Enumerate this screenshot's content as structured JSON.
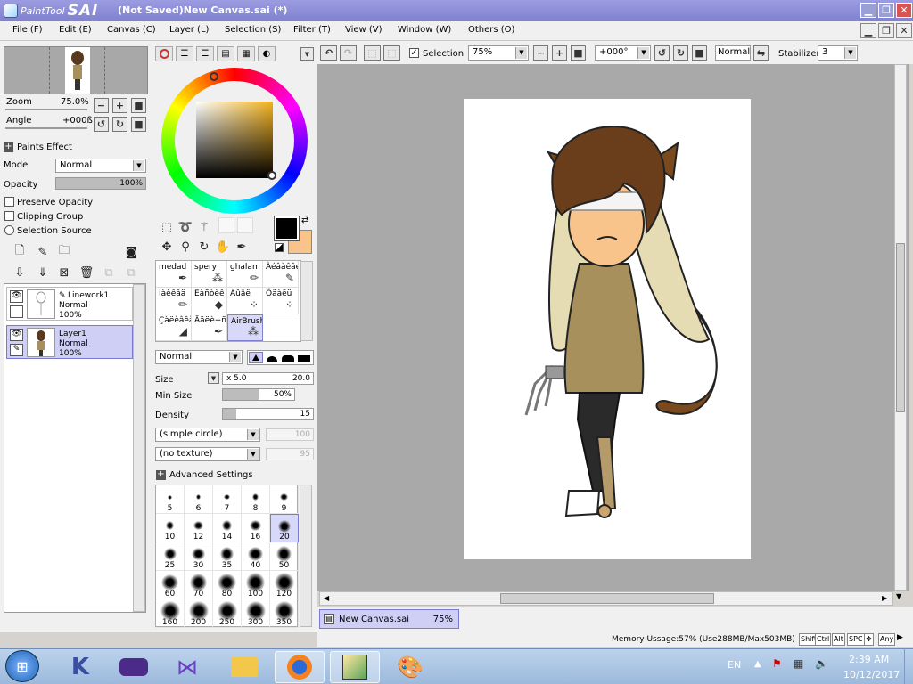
{
  "titlebar": {
    "logo_paint": "PaintTool",
    "logo_sai": "SAI",
    "title": "(Not Saved)New Canvas.sai (*)"
  },
  "menu": [
    "File (F)",
    "Edit (E)",
    "Canvas (C)",
    "Layer (L)",
    "Selection (S)",
    "Filter (T)",
    "View (V)",
    "Window (W)",
    "Others (O)"
  ],
  "navigator": {
    "zoom_label": "Zoom",
    "zoom_value": "75.0%",
    "angle_label": "Angle",
    "angle_value": "+000ß"
  },
  "paints_effect": {
    "header": "Paints Effect",
    "mode_label": "Mode",
    "mode_value": "Normal",
    "opacity_label": "Opacity",
    "opacity_value": "100%",
    "opacity_fraction": 1.0
  },
  "layer_options": {
    "preserve_opacity": "Preserve Opacity",
    "clipping_group": "Clipping Group",
    "selection_source": "Selection Source"
  },
  "layers": [
    {
      "name": "Linework1",
      "mode": "Normal",
      "opacity": "100%",
      "selected": false
    },
    {
      "name": "Layer1",
      "mode": "Normal",
      "opacity": "100%",
      "selected": true
    }
  ],
  "colors": {
    "primary": "#000000",
    "secondary": "#f9c48c",
    "accent": "#7f80d0",
    "canvas_bg": "#a9a9a9"
  },
  "brushes": [
    {
      "name": "medad",
      "icon": "pen-icon"
    },
    {
      "name": "spery",
      "icon": "spray-icon"
    },
    {
      "name": "ghalam",
      "icon": "pencil-icon"
    },
    {
      "name": "Àéâàêâé",
      "icon": "brush-icon"
    },
    {
      "name": "Íàèêâä",
      "icon": "pencil-icon"
    },
    {
      "name": "Ëàñòèê",
      "icon": "eraser-icon"
    },
    {
      "name": "Äûâë",
      "icon": "blur-icon"
    },
    {
      "name": "Óäàëü",
      "icon": "blur-icon"
    },
    {
      "name": "Çàëèâêà",
      "icon": "fill-icon"
    },
    {
      "name": "Äãëè÷ñ",
      "icon": "pen-icon"
    },
    {
      "name": "AirBrush",
      "icon": "airbrush-icon",
      "selected": true
    }
  ],
  "tool_settings": {
    "blend_mode": "Normal",
    "size_label": "Size",
    "size_multiplier": "x 5.0",
    "size_value": "20.0",
    "min_size_label": "Min Size",
    "min_size_value": "50%",
    "min_size_fraction": 0.5,
    "density_label": "Density",
    "density_value": "15",
    "density_fraction": 0.15,
    "shape": "(simple circle)",
    "shape_value": "100",
    "texture": "(no texture)",
    "texture_value": "95",
    "advanced": "Advanced Settings"
  },
  "brush_sizes": [
    "5",
    "6",
    "7",
    "8",
    "9",
    "10",
    "12",
    "14",
    "16",
    "20",
    "25",
    "30",
    "35",
    "40",
    "50",
    "60",
    "70",
    "80",
    "100",
    "120",
    "160",
    "200",
    "250",
    "300",
    "350"
  ],
  "selected_brush_size": "20",
  "toolbar": {
    "selection_label": "Selection",
    "zoom": "75%",
    "angle": "+000°",
    "blend": "Normal",
    "stabilizer_label": "Stabilizer",
    "stabilizer_value": "3"
  },
  "document_tab": {
    "name": "New Canvas.sai",
    "zoom": "75%"
  },
  "status": {
    "memory": "Memory Ussage:57% (Use288MB/Max503MB)",
    "keys": [
      "Shift",
      "Ctrl",
      "Alt",
      "SPC",
      "✥",
      "Any"
    ]
  },
  "taskbar": {
    "lang": "EN",
    "time": "2:39 AM",
    "date": "10/12/2017"
  }
}
